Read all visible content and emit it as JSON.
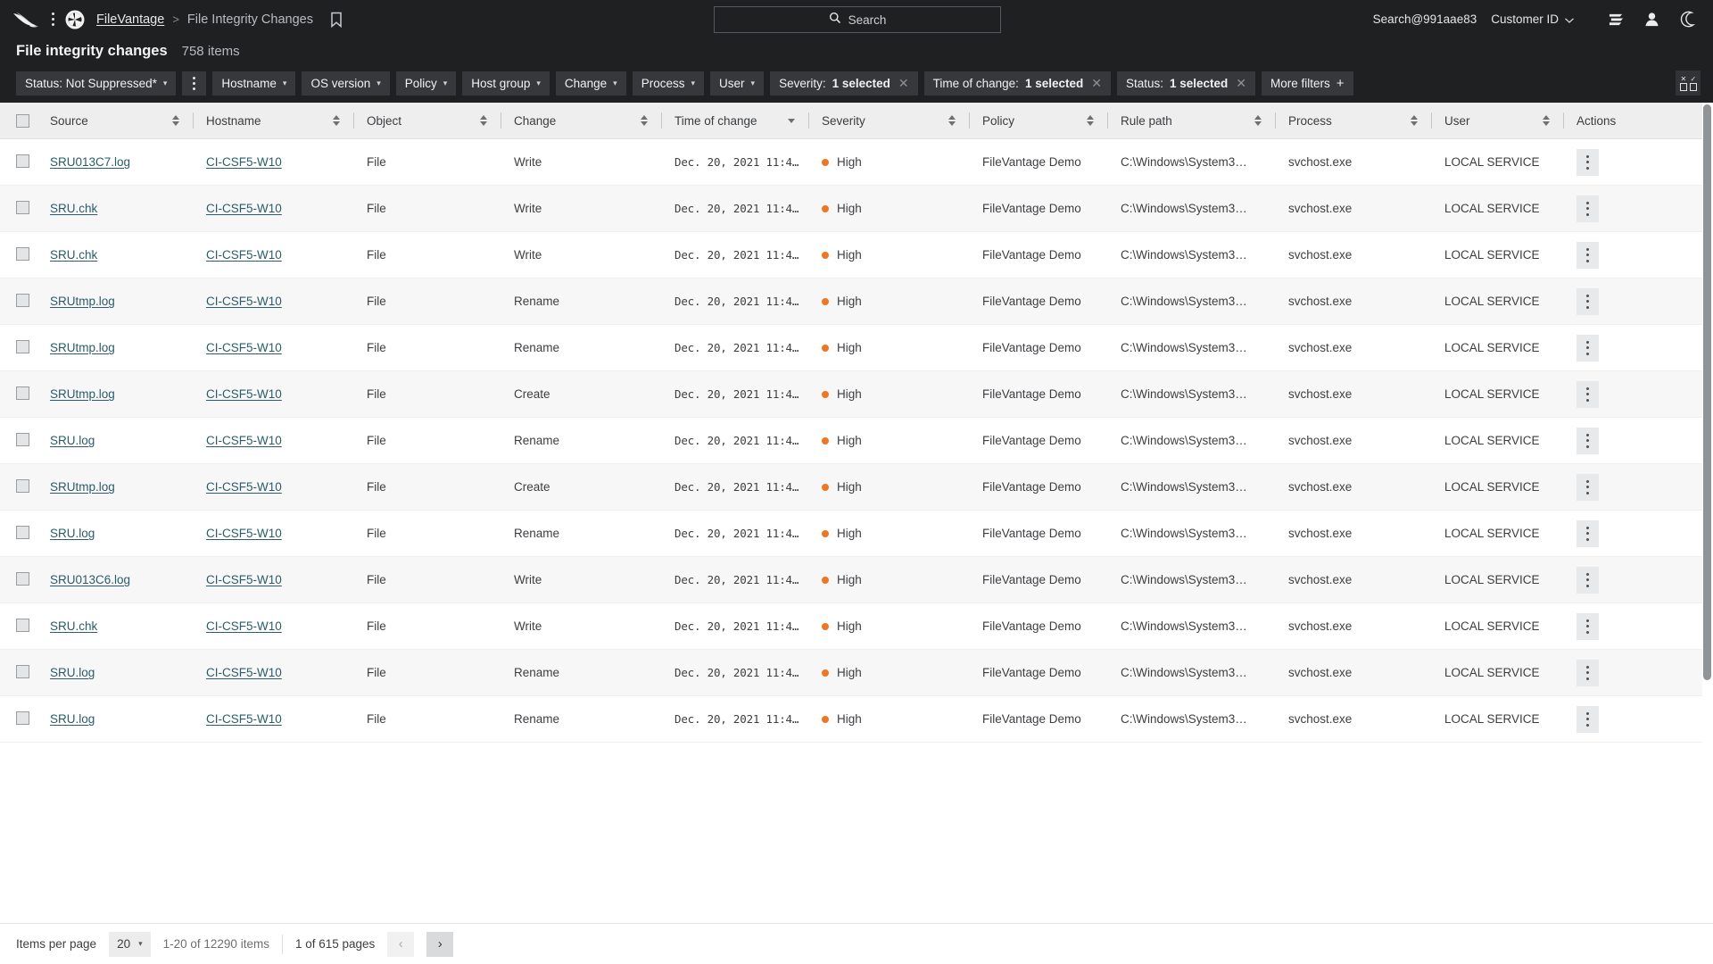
{
  "topnav": {
    "logo_icon": "falcon-logo-icon",
    "menu_icon": "kebab-menu-icon",
    "app_icon": "aperture-icon",
    "breadcrumb_root": "FileVantage",
    "breadcrumb_sep": ">",
    "breadcrumb_current": "File Integrity Changes",
    "bookmark_icon": "bookmark-icon",
    "search_placeholder": "Search",
    "search_icon": "search-icon",
    "user_label": "Search@991aae83",
    "customer_label": "Customer ID",
    "customer_chevron": "⌄",
    "queue_icon": "queue-icon",
    "account_icon": "person-icon",
    "theme_icon": "moon-icon"
  },
  "page": {
    "title": "File integrity changes",
    "count": "758 items"
  },
  "filters": {
    "chips": [
      {
        "label": "Status: Not Suppressed*",
        "type": "dropdown"
      },
      {
        "label": "Hostname",
        "type": "dropdown"
      },
      {
        "label": "OS version",
        "type": "dropdown"
      },
      {
        "label": "Policy",
        "type": "dropdown"
      },
      {
        "label": "Host group",
        "type": "dropdown"
      },
      {
        "label": "Change",
        "type": "dropdown"
      },
      {
        "label": "Process",
        "type": "dropdown"
      },
      {
        "label": "User",
        "type": "dropdown"
      },
      {
        "label": "Severity:",
        "value": "1 selected",
        "type": "removable"
      },
      {
        "label": "Time of change:",
        "value": "1 selected",
        "type": "removable"
      },
      {
        "label": "Status:",
        "value": "1 selected",
        "type": "removable"
      },
      {
        "label": "More filters",
        "type": "add"
      }
    ],
    "more_filters_plus": "+",
    "column_picker_icon": "column-select-icon"
  },
  "table": {
    "columns": [
      {
        "label": "",
        "sort": "none",
        "key": "checkbox"
      },
      {
        "label": "Source",
        "sort": "both"
      },
      {
        "label": "Hostname",
        "sort": "both"
      },
      {
        "label": "Object",
        "sort": "both"
      },
      {
        "label": "Change",
        "sort": "both"
      },
      {
        "label": "Time of change",
        "sort": "desc"
      },
      {
        "label": "Severity",
        "sort": "both"
      },
      {
        "label": "Policy",
        "sort": "both"
      },
      {
        "label": "Rule path",
        "sort": "both"
      },
      {
        "label": "Process",
        "sort": "both"
      },
      {
        "label": "User",
        "sort": "both"
      },
      {
        "label": "Actions",
        "sort": "none"
      }
    ],
    "rows": [
      {
        "source": "SRU013C7.log",
        "hostname": "CI-CSF5-W10",
        "object": "File",
        "change": "Write",
        "time": "Dec. 20, 2021 11:4…",
        "severity": "High",
        "policy": "FileVantage Demo",
        "rule_path": "C:\\Windows\\System3…",
        "process": "svchost.exe",
        "user": "LOCAL SERVICE"
      },
      {
        "source": "SRU.chk",
        "hostname": "CI-CSF5-W10",
        "object": "File",
        "change": "Write",
        "time": "Dec. 20, 2021 11:4…",
        "severity": "High",
        "policy": "FileVantage Demo",
        "rule_path": "C:\\Windows\\System3…",
        "process": "svchost.exe",
        "user": "LOCAL SERVICE"
      },
      {
        "source": "SRU.chk",
        "hostname": "CI-CSF5-W10",
        "object": "File",
        "change": "Write",
        "time": "Dec. 20, 2021 11:4…",
        "severity": "High",
        "policy": "FileVantage Demo",
        "rule_path": "C:\\Windows\\System3…",
        "process": "svchost.exe",
        "user": "LOCAL SERVICE"
      },
      {
        "source": "SRUtmp.log",
        "hostname": "CI-CSF5-W10",
        "object": "File",
        "change": "Rename",
        "time": "Dec. 20, 2021 11:4…",
        "severity": "High",
        "policy": "FileVantage Demo",
        "rule_path": "C:\\Windows\\System3…",
        "process": "svchost.exe",
        "user": "LOCAL SERVICE"
      },
      {
        "source": "SRUtmp.log",
        "hostname": "CI-CSF5-W10",
        "object": "File",
        "change": "Rename",
        "time": "Dec. 20, 2021 11:4…",
        "severity": "High",
        "policy": "FileVantage Demo",
        "rule_path": "C:\\Windows\\System3…",
        "process": "svchost.exe",
        "user": "LOCAL SERVICE"
      },
      {
        "source": "SRUtmp.log",
        "hostname": "CI-CSF5-W10",
        "object": "File",
        "change": "Create",
        "time": "Dec. 20, 2021 11:4…",
        "severity": "High",
        "policy": "FileVantage Demo",
        "rule_path": "C:\\Windows\\System3…",
        "process": "svchost.exe",
        "user": "LOCAL SERVICE"
      },
      {
        "source": "SRU.log",
        "hostname": "CI-CSF5-W10",
        "object": "File",
        "change": "Rename",
        "time": "Dec. 20, 2021 11:4…",
        "severity": "High",
        "policy": "FileVantage Demo",
        "rule_path": "C:\\Windows\\System3…",
        "process": "svchost.exe",
        "user": "LOCAL SERVICE"
      },
      {
        "source": "SRUtmp.log",
        "hostname": "CI-CSF5-W10",
        "object": "File",
        "change": "Create",
        "time": "Dec. 20, 2021 11:4…",
        "severity": "High",
        "policy": "FileVantage Demo",
        "rule_path": "C:\\Windows\\System3…",
        "process": "svchost.exe",
        "user": "LOCAL SERVICE"
      },
      {
        "source": "SRU.log",
        "hostname": "CI-CSF5-W10",
        "object": "File",
        "change": "Rename",
        "time": "Dec. 20, 2021 11:4…",
        "severity": "High",
        "policy": "FileVantage Demo",
        "rule_path": "C:\\Windows\\System3…",
        "process": "svchost.exe",
        "user": "LOCAL SERVICE"
      },
      {
        "source": "SRU013C6.log",
        "hostname": "CI-CSF5-W10",
        "object": "File",
        "change": "Write",
        "time": "Dec. 20, 2021 11:4…",
        "severity": "High",
        "policy": "FileVantage Demo",
        "rule_path": "C:\\Windows\\System3…",
        "process": "svchost.exe",
        "user": "LOCAL SERVICE"
      },
      {
        "source": "SRU.chk",
        "hostname": "CI-CSF5-W10",
        "object": "File",
        "change": "Write",
        "time": "Dec. 20, 2021 11:4…",
        "severity": "High",
        "policy": "FileVantage Demo",
        "rule_path": "C:\\Windows\\System3…",
        "process": "svchost.exe",
        "user": "LOCAL SERVICE"
      },
      {
        "source": "SRU.log",
        "hostname": "CI-CSF5-W10",
        "object": "File",
        "change": "Rename",
        "time": "Dec. 20, 2021 11:4…",
        "severity": "High",
        "policy": "FileVantage Demo",
        "rule_path": "C:\\Windows\\System3…",
        "process": "svchost.exe",
        "user": "LOCAL SERVICE"
      },
      {
        "source": "SRU.log",
        "hostname": "CI-CSF5-W10",
        "object": "File",
        "change": "Rename",
        "time": "Dec. 20, 2021 11:4…",
        "severity": "High",
        "policy": "FileVantage Demo",
        "rule_path": "C:\\Windows\\System3…",
        "process": "svchost.exe",
        "user": "LOCAL SERVICE"
      }
    ],
    "action_menu_icon": "kebab-menu-icon"
  },
  "footer": {
    "items_per_page_label": "Items per page",
    "items_per_page_value": "20",
    "chevron": "⌄",
    "range": "1-20 of 12290 items",
    "pages": "1 of 615 pages",
    "prev_icon": "chevron-left-icon",
    "next_icon": "chevron-right-icon",
    "prev_glyph": "‹",
    "next_glyph": "›"
  },
  "colors": {
    "nav_bg": "#1f2022",
    "severity_high": "#ef7622",
    "link": "#2b5c6b",
    "header_bg": "#eeeeee",
    "row_alt": "#f7f7f7"
  }
}
